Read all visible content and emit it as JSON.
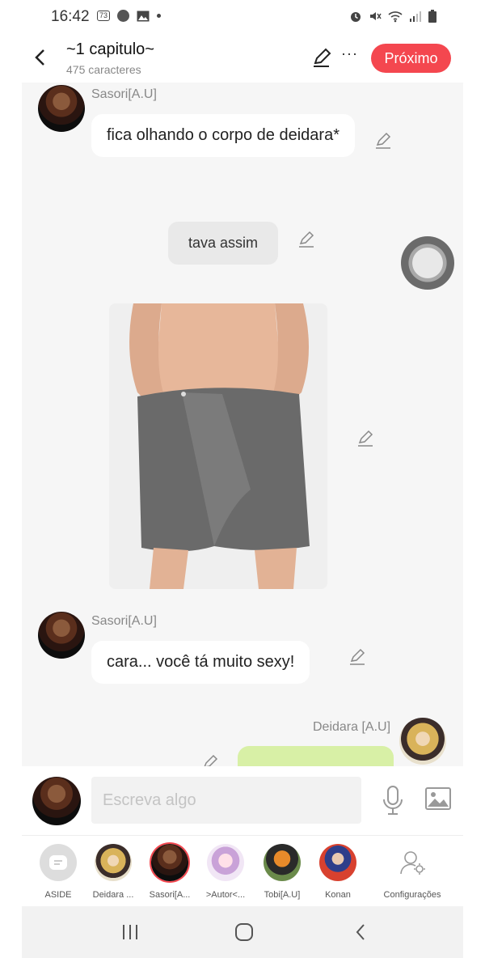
{
  "status_bar": {
    "time": "16:42",
    "notification_badge": "73"
  },
  "header": {
    "title": "~1 capitulo~",
    "subtitle": "475 caracteres",
    "more_label": "···",
    "next_label": "Próximo",
    "accent_color": "#f4474f"
  },
  "messages": [
    {
      "speaker": "Sasori[A.U]",
      "text": "fica olhando o corpo de deidara*"
    },
    {
      "text": "tava assim"
    },
    {
      "type": "image",
      "icon": "photo-image"
    },
    {
      "speaker": "Sasori[A.U]",
      "text": "cara... você  tá  muito sexy!"
    },
    {
      "speaker": "Deidara [A.U]",
      "text": ""
    }
  ],
  "composer": {
    "placeholder": "Escreva algo"
  },
  "characters": [
    {
      "label": "ASIDE"
    },
    {
      "label": "Deidara ..."
    },
    {
      "label": "Sasori[A..."
    },
    {
      "label": ">Autor<..."
    },
    {
      "label": "Tobi[A.U]"
    },
    {
      "label": "Konan"
    },
    {
      "label": "Configurações"
    }
  ]
}
